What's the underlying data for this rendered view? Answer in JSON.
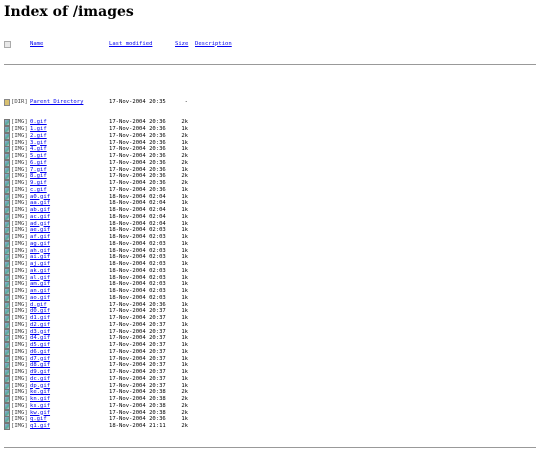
{
  "page": {
    "title": "Index of /images"
  },
  "header": {
    "name": "Name",
    "last_modified": "Last modified",
    "size": "Size",
    "description": "Description"
  },
  "parent": {
    "tag": "[DIR]",
    "name": "Parent Directory",
    "date": "17-Nov-2004 20:35",
    "size": "-"
  },
  "rows": [
    {
      "tag": "[IMG]",
      "name": "0.gif",
      "date": "17-Nov-2004 20:36",
      "size": "2k"
    },
    {
      "tag": "[IMG]",
      "name": "1.gif",
      "date": "17-Nov-2004 20:36",
      "size": "1k"
    },
    {
      "tag": "[IMG]",
      "name": "2.gif",
      "date": "17-Nov-2004 20:36",
      "size": "2k"
    },
    {
      "tag": "[IMG]",
      "name": "3.gif",
      "date": "17-Nov-2004 20:36",
      "size": "1k"
    },
    {
      "tag": "[IMG]",
      "name": "4.gif",
      "date": "17-Nov-2004 20:36",
      "size": "1k"
    },
    {
      "tag": "[IMG]",
      "name": "5.gif",
      "date": "17-Nov-2004 20:36",
      "size": "2k"
    },
    {
      "tag": "[IMG]",
      "name": "6.gif",
      "date": "17-Nov-2004 20:36",
      "size": "2k"
    },
    {
      "tag": "[IMG]",
      "name": "7.gif",
      "date": "17-Nov-2004 20:36",
      "size": "1k"
    },
    {
      "tag": "[IMG]",
      "name": "8.gif",
      "date": "17-Nov-2004 20:36",
      "size": "2k"
    },
    {
      "tag": "[IMG]",
      "name": "9.gif",
      "date": "17-Nov-2004 20:36",
      "size": "2k"
    },
    {
      "tag": "[IMG]",
      "name": "c.gif",
      "date": "17-Nov-2004 20:36",
      "size": "1k"
    },
    {
      "tag": "[IMG]",
      "name": "a0.gif",
      "date": "18-Nov-2004 02:04",
      "size": "1k"
    },
    {
      "tag": "[IMG]",
      "name": "aa.gif",
      "date": "18-Nov-2004 02:04",
      "size": "1k"
    },
    {
      "tag": "[IMG]",
      "name": "ab.gif",
      "date": "18-Nov-2004 02:04",
      "size": "1k"
    },
    {
      "tag": "[IMG]",
      "name": "ac.gif",
      "date": "18-Nov-2004 02:04",
      "size": "1k"
    },
    {
      "tag": "[IMG]",
      "name": "ad.gif",
      "date": "18-Nov-2004 02:04",
      "size": "1k"
    },
    {
      "tag": "[IMG]",
      "name": "ae.gif",
      "date": "18-Nov-2004 02:03",
      "size": "1k"
    },
    {
      "tag": "[IMG]",
      "name": "af.gif",
      "date": "18-Nov-2004 02:03",
      "size": "1k"
    },
    {
      "tag": "[IMG]",
      "name": "ag.gif",
      "date": "18-Nov-2004 02:03",
      "size": "1k"
    },
    {
      "tag": "[IMG]",
      "name": "ah.gif",
      "date": "18-Nov-2004 02:03",
      "size": "1k"
    },
    {
      "tag": "[IMG]",
      "name": "ai.gif",
      "date": "18-Nov-2004 02:03",
      "size": "1k"
    },
    {
      "tag": "[IMG]",
      "name": "aj.gif",
      "date": "18-Nov-2004 02:03",
      "size": "1k"
    },
    {
      "tag": "[IMG]",
      "name": "ak.gif",
      "date": "18-Nov-2004 02:03",
      "size": "1k"
    },
    {
      "tag": "[IMG]",
      "name": "al.gif",
      "date": "18-Nov-2004 02:03",
      "size": "1k"
    },
    {
      "tag": "[IMG]",
      "name": "am.gif",
      "date": "18-Nov-2004 02:03",
      "size": "1k"
    },
    {
      "tag": "[IMG]",
      "name": "an.gif",
      "date": "18-Nov-2004 02:03",
      "size": "1k"
    },
    {
      "tag": "[IMG]",
      "name": "ao.gif",
      "date": "18-Nov-2004 02:03",
      "size": "1k"
    },
    {
      "tag": "[IMG]",
      "name": "d.gif",
      "date": "17-Nov-2004 20:36",
      "size": "1k"
    },
    {
      "tag": "[IMG]",
      "name": "d0.gif",
      "date": "17-Nov-2004 20:37",
      "size": "1k"
    },
    {
      "tag": "[IMG]",
      "name": "d1.gif",
      "date": "17-Nov-2004 20:37",
      "size": "1k"
    },
    {
      "tag": "[IMG]",
      "name": "d2.gif",
      "date": "17-Nov-2004 20:37",
      "size": "1k"
    },
    {
      "tag": "[IMG]",
      "name": "d3.gif",
      "date": "17-Nov-2004 20:37",
      "size": "1k"
    },
    {
      "tag": "[IMG]",
      "name": "d4.gif",
      "date": "17-Nov-2004 20:37",
      "size": "1k"
    },
    {
      "tag": "[IMG]",
      "name": "d5.gif",
      "date": "17-Nov-2004 20:37",
      "size": "1k"
    },
    {
      "tag": "[IMG]",
      "name": "d6.gif",
      "date": "17-Nov-2004 20:37",
      "size": "1k"
    },
    {
      "tag": "[IMG]",
      "name": "d7.gif",
      "date": "17-Nov-2004 20:37",
      "size": "1k"
    },
    {
      "tag": "[IMG]",
      "name": "d8.gif",
      "date": "17-Nov-2004 20:37",
      "size": "1k"
    },
    {
      "tag": "[IMG]",
      "name": "d9.gif",
      "date": "17-Nov-2004 20:37",
      "size": "1k"
    },
    {
      "tag": "[IMG]",
      "name": "dc.gif",
      "date": "17-Nov-2004 20:37",
      "size": "1k"
    },
    {
      "tag": "[IMG]",
      "name": "dp.gif",
      "date": "17-Nov-2004 20:37",
      "size": "1k"
    },
    {
      "tag": "[IMG]",
      "name": "ke.gif",
      "date": "17-Nov-2004 20:38",
      "size": "2k"
    },
    {
      "tag": "[IMG]",
      "name": "kn.gif",
      "date": "17-Nov-2004 20:38",
      "size": "2k"
    },
    {
      "tag": "[IMG]",
      "name": "ks.gif",
      "date": "17-Nov-2004 20:38",
      "size": "2k"
    },
    {
      "tag": "[IMG]",
      "name": "kw.gif",
      "date": "17-Nov-2004 20:38",
      "size": "2k"
    },
    {
      "tag": "[IMG]",
      "name": "q.gif",
      "date": "17-Nov-2004 20:36",
      "size": "1k"
    },
    {
      "tag": "[IMG]",
      "name": "q1.gif",
      "date": "18-Nov-2004 21:11",
      "size": "2k"
    }
  ]
}
